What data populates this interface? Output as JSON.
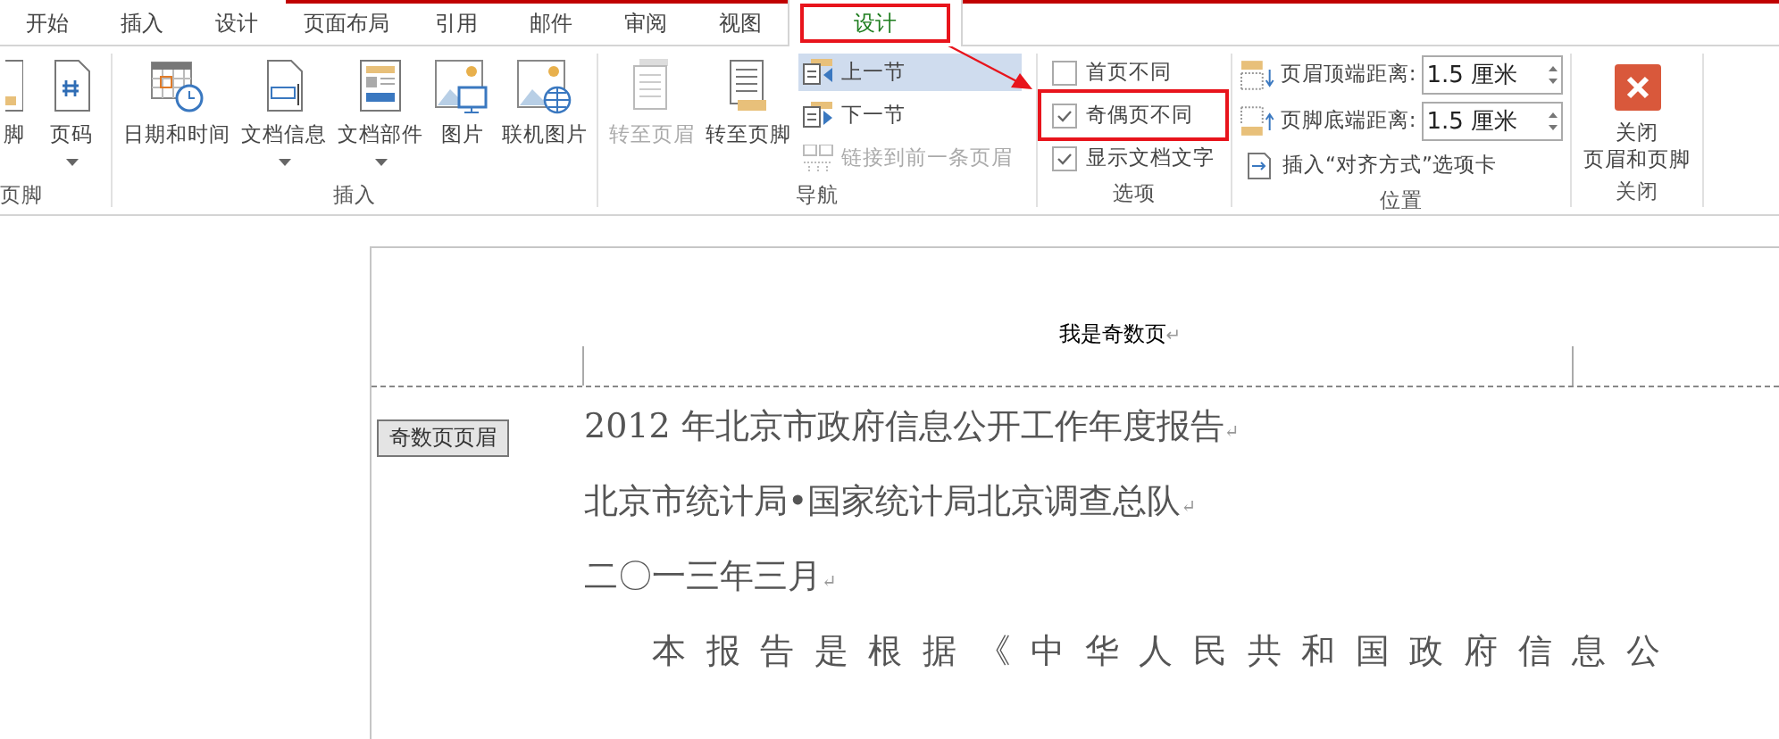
{
  "tabs": [
    {
      "label": "开始",
      "selected": false,
      "annotated": false
    },
    {
      "label": "插入",
      "selected": false,
      "annotated": false
    },
    {
      "label": "设计",
      "selected": false,
      "annotated": false
    },
    {
      "label": "页面布局",
      "selected": false,
      "annotated": false
    },
    {
      "label": "引用",
      "selected": false,
      "annotated": false
    },
    {
      "label": "邮件",
      "selected": false,
      "annotated": false
    },
    {
      "label": "审阅",
      "selected": false,
      "annotated": false
    },
    {
      "label": "视图",
      "selected": false,
      "annotated": false
    },
    {
      "label": "设计",
      "selected": true,
      "annotated": true
    }
  ],
  "ribbon": {
    "groups": [
      {
        "label": "页脚",
        "items": [
          {
            "kind": "large",
            "label": "脚",
            "disabled": false
          },
          {
            "kind": "large",
            "label": "页码",
            "dropdown": true,
            "disabled": false
          }
        ]
      },
      {
        "label": "插入",
        "items": [
          {
            "kind": "large",
            "label": "日期和时间",
            "dropdown": false,
            "disabled": false
          },
          {
            "kind": "large",
            "label": "文档信息",
            "dropdown": true,
            "disabled": false
          },
          {
            "kind": "large",
            "label": "文档部件",
            "dropdown": true,
            "disabled": false
          },
          {
            "kind": "large",
            "label": "图片",
            "dropdown": false,
            "disabled": false
          },
          {
            "kind": "large",
            "label": "联机图片",
            "dropdown": false,
            "disabled": false
          }
        ]
      },
      {
        "label": "导航",
        "items": [
          {
            "kind": "large",
            "label": "转至页眉",
            "dropdown": false,
            "disabled": true
          },
          {
            "kind": "large",
            "label": "转至页脚",
            "dropdown": false,
            "disabled": false
          },
          {
            "kind": "small",
            "label": "上一节",
            "highlighted": true,
            "disabled": false
          },
          {
            "kind": "small",
            "label": "下一节",
            "highlighted": false,
            "disabled": false
          },
          {
            "kind": "small",
            "label": "链接到前一条页眉",
            "highlighted": false,
            "disabled": true
          }
        ]
      },
      {
        "label": "选项",
        "items": [
          {
            "kind": "checkbox",
            "label": "首页不同",
            "checked": false,
            "annotated": false
          },
          {
            "kind": "checkbox",
            "label": "奇偶页不同",
            "checked": true,
            "annotated": true
          },
          {
            "kind": "checkbox",
            "label": "显示文档文字",
            "checked": true,
            "annotated": false
          }
        ]
      },
      {
        "label": "位置",
        "items": [
          {
            "kind": "spinner",
            "label": "页眉顶端距离:",
            "value": "1.5 厘米"
          },
          {
            "kind": "spinner",
            "label": "页脚底端距离:",
            "value": "1.5 厘米"
          },
          {
            "kind": "small",
            "label": "插入“对齐方式”选项卡",
            "highlighted": false,
            "disabled": false
          }
        ]
      },
      {
        "label": "关闭",
        "items": [
          {
            "kind": "close",
            "label_lines": [
              "关闭",
              "页眉和页脚"
            ]
          }
        ]
      }
    ]
  },
  "document": {
    "header_text": "我是奇数页",
    "header_mark": "↵",
    "header_tag": "奇数页页眉",
    "paragraphs": [
      {
        "text": "2012 年北京市政府信息公开工作年度报告",
        "mark": "↵",
        "indent": false
      },
      {
        "text": "北京市统计局•国家统计局北京调查总队",
        "mark": "↵",
        "indent": false
      },
      {
        "text": "二〇一三年三月",
        "mark": "↵",
        "indent": false
      },
      {
        "text": "本报告是根据《中华人民共和国政府信息公",
        "indent": true
      }
    ]
  }
}
